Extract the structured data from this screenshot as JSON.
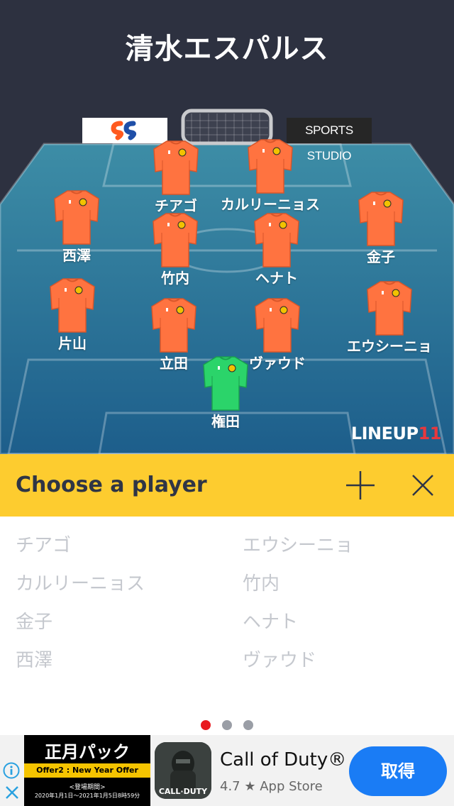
{
  "team_title": "清水エスパルス",
  "sponsor_right": "SPORTS STUDIO",
  "brand": {
    "text": "LINEUP",
    "num": "11"
  },
  "players": [
    {
      "id": "chiago",
      "name": "チアゴ",
      "kit": "orange"
    },
    {
      "id": "carlinhos",
      "name": "カルリーニョス",
      "kit": "orange"
    },
    {
      "id": "nishizawa",
      "name": "西澤",
      "kit": "orange"
    },
    {
      "id": "kaneko",
      "name": "金子",
      "kit": "orange"
    },
    {
      "id": "takeuchi",
      "name": "竹内",
      "kit": "orange"
    },
    {
      "id": "henato",
      "name": "ヘナト",
      "kit": "orange"
    },
    {
      "id": "katayama",
      "name": "片山",
      "kit": "orange"
    },
    {
      "id": "ewerthon",
      "name": "エウシーニョ",
      "kit": "orange"
    },
    {
      "id": "tatsuta",
      "name": "立田",
      "kit": "orange"
    },
    {
      "id": "valdo",
      "name": "ヴァウド",
      "kit": "orange"
    },
    {
      "id": "gonda",
      "name": "権田",
      "kit": "green"
    }
  ],
  "choose_bar": {
    "title": "Choose a player"
  },
  "bench": {
    "left": [
      "チアゴ",
      "カルリーニョス",
      "金子",
      "西澤"
    ],
    "right": [
      "エウシーニョ",
      "竹内",
      "ヘナト",
      "ヴァウド"
    ]
  },
  "pager": {
    "pages": 3,
    "current": 1
  },
  "ad": {
    "banner_title": "正月パック",
    "banner_offer": "Offer2 : New Year Offer",
    "banner_period_label": "<登場期間>",
    "banner_period": "2020年1月1日～2021年1月5日8時59分",
    "icon_label": "CALL·DUTY",
    "app_name": "Call of Duty®",
    "rating": "4.7",
    "store": "App Store",
    "install_label": "取得"
  },
  "colors": {
    "accent_yellow": "#fdcc2f",
    "kit_orange": "#ff7340",
    "kit_green": "#2bd46a",
    "active_dot": "#e8191e",
    "install_blue": "#1a7cf5"
  }
}
